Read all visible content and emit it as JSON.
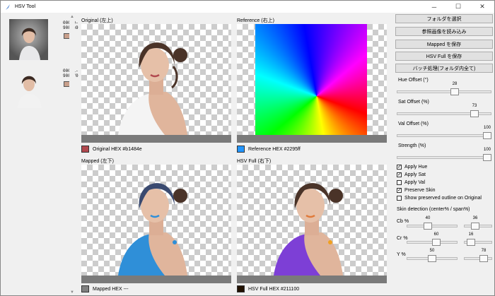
{
  "window": {
    "title": "HSV Tool",
    "minimize": "─",
    "maximize": "☐",
    "close": "✕"
  },
  "thumbnails": [
    {
      "name": "00050-\n908069",
      "swatch": "#c9a08c"
    },
    {
      "name": "00051-\n908070",
      "swatch": "#c9a08c"
    }
  ],
  "panels": {
    "original": {
      "label": "Original (左上)",
      "hex_label": "Original HEX #b1484e",
      "swatch": "#b1484e"
    },
    "reference": {
      "label": "Reference (右上)",
      "hex_label": "Reference HEX #2295ff",
      "swatch": "#2295ff"
    },
    "mapped": {
      "label": "Mapped (左下)",
      "hex_label": "Mapped HEX ---",
      "swatch": "#808080"
    },
    "hsvfull": {
      "label": "HSV Full (右下)",
      "hex_label": "HSV Full HEX #211100",
      "swatch": "#211100"
    }
  },
  "buttons": {
    "select_folder": "フォルダを選択",
    "load_reference": "参照画像を読み込み",
    "save_mapped": "Mapped を保存",
    "save_hsvfull": "HSV Full を保存",
    "batch": "バッチ処理(フォルダ内全て)"
  },
  "controls": {
    "hue_offset": {
      "label": "Hue Offset (°)",
      "value": "28",
      "fraction": 0.62
    },
    "sat_offset": {
      "label": "Sat Offset (%)",
      "value": "73",
      "fraction": 0.85
    },
    "val_offset": {
      "label": "Val Offset (%)",
      "value": "100",
      "fraction": 1.0
    },
    "strength": {
      "label": "Strength (%)",
      "value": "100",
      "fraction": 1.0
    }
  },
  "checkboxes": [
    {
      "label": "Apply Hue",
      "checked": true
    },
    {
      "label": "Apply Sat",
      "checked": true
    },
    {
      "label": "Apply Val",
      "checked": false
    },
    {
      "label": "Preserve Skin",
      "checked": true
    },
    {
      "label": "Show preserved outline on Original",
      "checked": false
    }
  ],
  "skin": {
    "title": "Skin detection (center% / span%)",
    "cb": {
      "label": "Cb %",
      "center": "40",
      "center_frac": 0.4,
      "span": "36",
      "span_frac": 0.36
    },
    "cr": {
      "label": "Cr %",
      "center": "60",
      "center_frac": 0.6,
      "span": "16",
      "span_frac": 0.16
    },
    "y": {
      "label": "Y %",
      "center": "50",
      "center_frac": 0.5,
      "span": "78",
      "span_frac": 0.78
    }
  },
  "colors": {
    "skin": "#d9b29c",
    "hair": "#4a3328",
    "towel_blue": "#2f8fd8",
    "towel_purple": "#7d3fd6"
  }
}
